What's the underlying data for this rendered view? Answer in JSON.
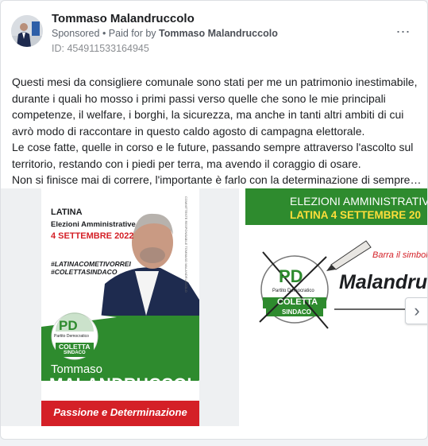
{
  "post": {
    "page_name": "Tommaso Malandruccolo",
    "sponsored_label": "Sponsored",
    "paid_for_prefix": " • Paid for by ",
    "paid_for_name": "Tommaso Malandruccolo",
    "ad_id": "ID: 454911533164945",
    "more_icon": "⋯",
    "text_lines": [
      "Questi mesi da consigliere comunale sono stati per me un patrimonio inestimabile,",
      "durante i quali ho mosso i primi passi verso quelle che sono le mie principali",
      "competenze, il welfare, i borghi, la sicurezza, ma anche in tanti altri ambiti di cui",
      "avrò modo di raccontare in questo caldo agosto di campagna elettorale.",
      "Le cose fatte, quelle in corso e le future, passando sempre attraverso l'ascolto sul",
      "territorio, restando con i piedi per terra, ma avendo il coraggio di osare.",
      "Non si finisce mai di correre, l'importante è farlo con la determinazione di sempre…"
    ]
  },
  "poster": {
    "city": "LATINA",
    "election": "Elezioni Amministrative",
    "date": "4 SETTEMBRE 2022",
    "hashtag1": "#LATINACOMETIVORREI",
    "hashtag2": "#COLETTASINDACO",
    "side_text": "COMMITTENTE RESPONSABILE TOMMASO MALANDRUCCOLO",
    "party_logo": "PD",
    "party_name": "Partito Democratico",
    "coletta": "COLETTA",
    "sindaco": "SINDACO",
    "first_name": "Tommaso",
    "last_name": "MALANDRUCCOLO",
    "slogan": "Passione e Determinazione",
    "colors": {
      "green": "#2e8b2e",
      "red": "#d42027",
      "navy": "#1e2b4f"
    }
  },
  "slide2": {
    "banner_line1": "ELEZIONI AMMINISTRATIV",
    "banner_line2": "LATINA 4 SETTEMBRE 20",
    "instruction": "Barra il simbolo e",
    "party_logo": "PD",
    "party_name": "Partito Democratico",
    "coletta": "COLETTA",
    "sindaco": "SINDACO",
    "surname": "Malandruc"
  },
  "carousel": {
    "next_icon": "›"
  }
}
